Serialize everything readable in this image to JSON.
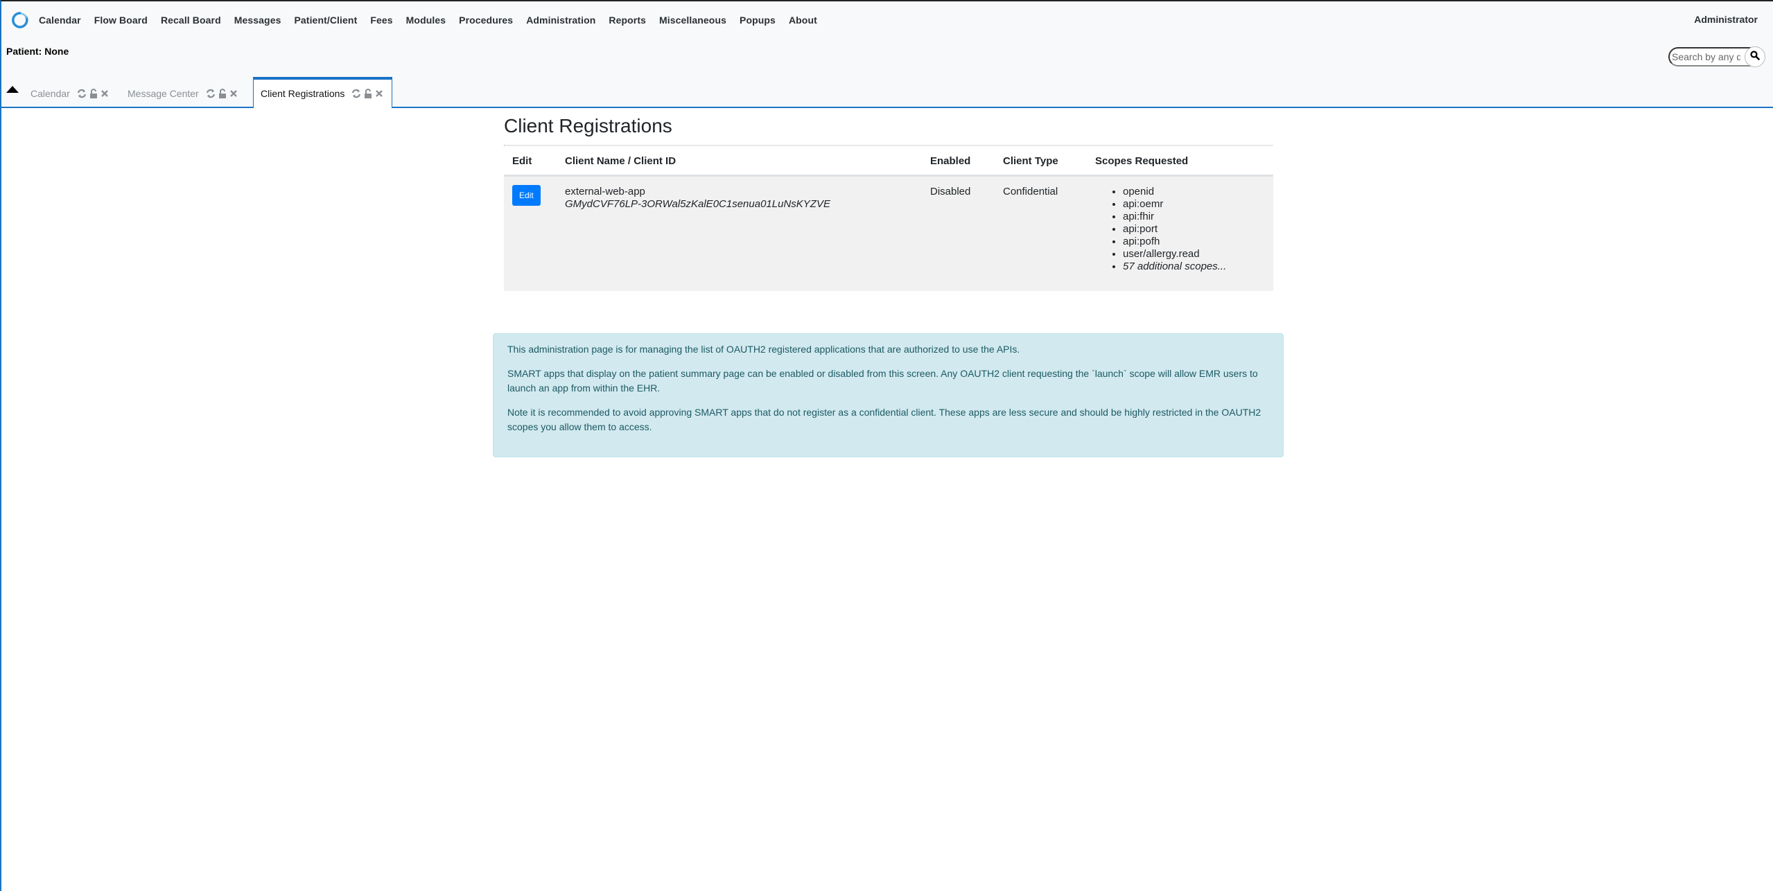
{
  "nav": {
    "items": [
      "Calendar",
      "Flow Board",
      "Recall Board",
      "Messages",
      "Patient/Client",
      "Fees",
      "Modules",
      "Procedures",
      "Administration",
      "Reports",
      "Miscellaneous",
      "Popups",
      "About"
    ],
    "user": "Administrator"
  },
  "patient": {
    "label": "Patient: None"
  },
  "search": {
    "placeholder": "Search by any demographics"
  },
  "tabs": [
    {
      "label": "Calendar",
      "active": false
    },
    {
      "label": "Message Center",
      "active": false
    },
    {
      "label": "Client Registrations",
      "active": true
    }
  ],
  "page": {
    "title": "Client Registrations",
    "table": {
      "headers": [
        "Edit",
        "Client Name / Client ID",
        "Enabled",
        "Client Type",
        "Scopes Requested"
      ],
      "rows": [
        {
          "edit_label": "Edit",
          "client_name": "external-web-app",
          "client_id": "GMydCVF76LP-3ORWal5zKalE0C1senua01LuNsKYZVE",
          "enabled": "Disabled",
          "client_type": "Confidential",
          "scopes": [
            "openid",
            "api:oemr",
            "api:fhir",
            "api:port",
            "api:pofh",
            "user/allergy.read"
          ],
          "more_scopes": "57 additional scopes..."
        }
      ]
    },
    "info": [
      "This administration page is for managing the list of OAUTH2 registered applications that are authorized to use the APIs.",
      "SMART apps that display on the patient summary page can be enabled or disabled from this screen. Any OAUTH2 client requesting the `launch` scope will allow EMR users to launch an app from within the EHR.",
      "Note it is recommended to avoid approving SMART apps that do not register as a confidential client. These apps are less secure and should be highly restricted in the OAUTH2 scopes you allow them to access."
    ]
  },
  "colors": {
    "accent": "#1a73c5",
    "button": "#007bff",
    "info_bg": "#d1e9ef",
    "info_text": "#1d5a63"
  }
}
